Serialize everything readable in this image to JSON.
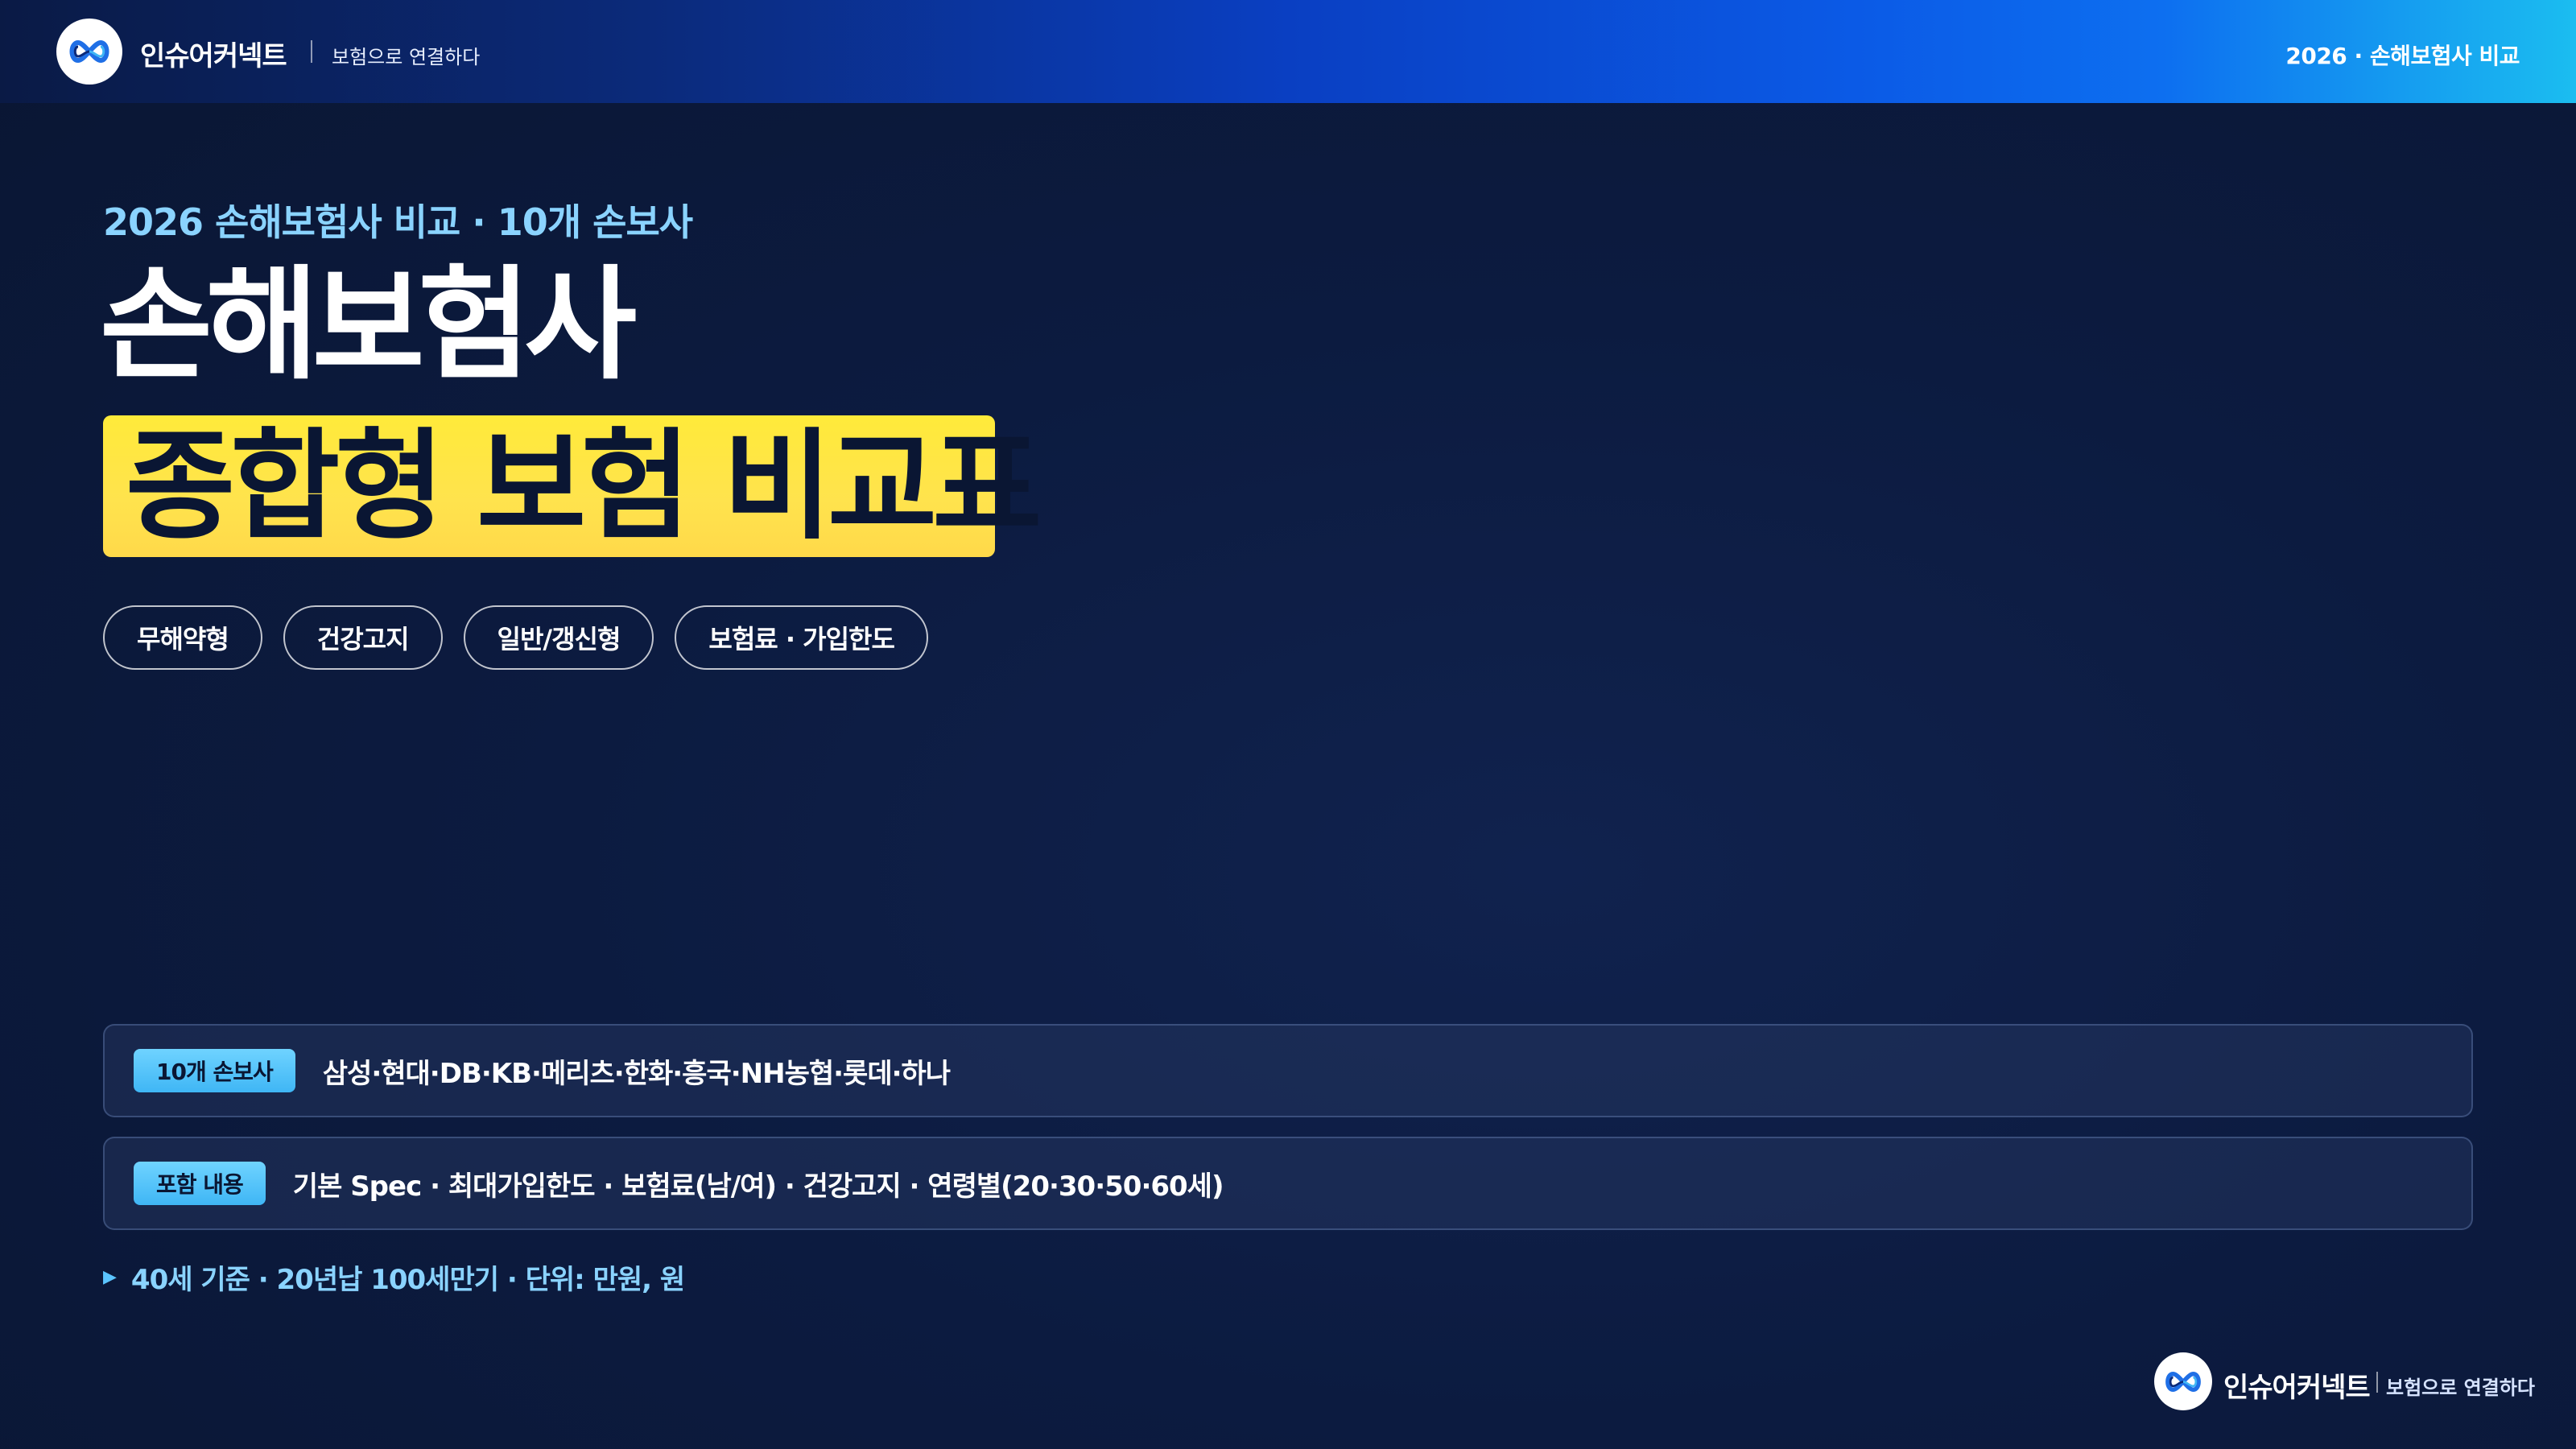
{
  "header": {
    "brand": "인슈어커넥트",
    "tagline": "보험으로 연결하다",
    "right_label": "2026 · 손해보험사 비교"
  },
  "hero": {
    "eyebrow": "2026 손해보험사 비교 · 10개 손보사",
    "title_line1": "손해보험사",
    "title_line2": "종합형 보험 비교표",
    "chips": [
      "무해약형",
      "건강고지",
      "일반/갱신형",
      "보험료 · 가입한도"
    ]
  },
  "info": {
    "insurers_badge": "10개 손보사",
    "insurers_text": "삼성·현대·DB·KB·메리츠·한화·흥국·NH농협·롯데·하나",
    "contents_badge": "포함 내용",
    "contents_text": "기본 Spec · 최대가입한도 · 보험료(남/여) · 건강고지 · 연령별(20·30·50·60세)",
    "note_icon": "triangle-right-icon",
    "note_text": "40세 기준 · 20년납 100세만기 · 단위: 만원, 원"
  },
  "footer": {
    "brand": "인슈어커넥트",
    "tagline": "보험으로 연결하다"
  },
  "colors": {
    "background": "#0b1838",
    "accent_yellow": "#ffe34d",
    "accent_cyan": "#5bc4ff",
    "header_gradient_end": "#1bbdf0"
  }
}
